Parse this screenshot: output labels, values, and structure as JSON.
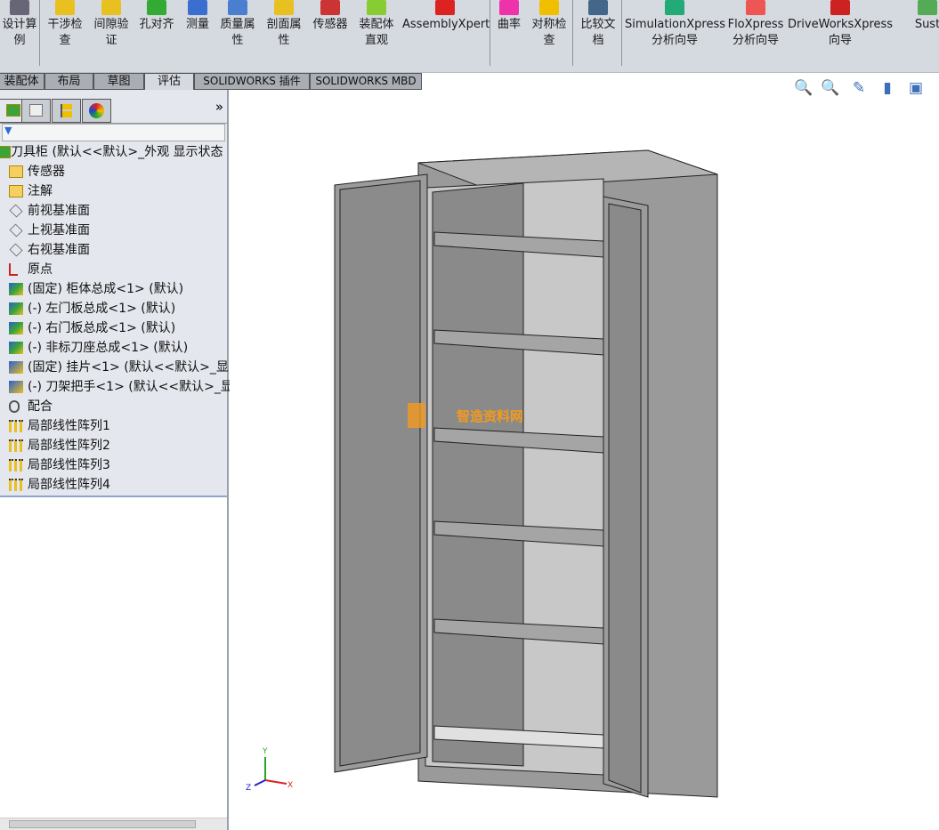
{
  "toolbar": {
    "items": [
      {
        "label": "设计算\n例",
        "icon": "design-study-icon"
      },
      {
        "label": "干涉检\n查",
        "icon": "interference-icon"
      },
      {
        "label": "间隙验\n证",
        "icon": "clearance-icon"
      },
      {
        "label": "孔对齐",
        "icon": "hole-align-icon"
      },
      {
        "label": "测量",
        "icon": "measure-icon"
      },
      {
        "label": "质量属\n性",
        "icon": "mass-properties-icon"
      },
      {
        "label": "剖面属\n性",
        "icon": "section-properties-icon"
      },
      {
        "label": "传感器",
        "icon": "sensor-icon"
      },
      {
        "label": "装配体\n直观",
        "icon": "assembly-visualization-icon"
      },
      {
        "label": "AssemblyXpert",
        "icon": "assemblyxpert-icon"
      },
      {
        "label": "曲率",
        "icon": "curvature-icon"
      },
      {
        "label": "对称检\n查",
        "icon": "symmetry-check-icon"
      },
      {
        "label": "比较文\n档",
        "icon": "compare-documents-icon"
      },
      {
        "label": "SimulationXpress\n分析向导",
        "icon": "simulationxpress-icon"
      },
      {
        "label": "FloXpress\n分析向导",
        "icon": "floxpress-icon"
      },
      {
        "label": "DriveWorksXpress\n向导",
        "icon": "driveworksxpress-icon"
      },
      {
        "label": "Sust",
        "icon": "sustainability-icon"
      }
    ]
  },
  "tabs": [
    {
      "label": "装配体"
    },
    {
      "label": "布局"
    },
    {
      "label": "草图"
    },
    {
      "label": "评估",
      "active": true
    },
    {
      "label": "SOLIDWORKS 插件"
    },
    {
      "label": "SOLIDWORKS MBD"
    }
  ],
  "panel": {
    "expand": "»",
    "filter": "▼",
    "tree": [
      {
        "label": "刀具柜  (默认<<默认>_外观 显示状态",
        "icon": "assembly-icon"
      },
      {
        "label": "传感器",
        "icon": "sensor-folder-icon"
      },
      {
        "label": "注解",
        "icon": "annotation-folder-icon"
      },
      {
        "label": "前视基准面",
        "icon": "plane-icon"
      },
      {
        "label": "上视基准面",
        "icon": "plane-icon"
      },
      {
        "label": "右视基准面",
        "icon": "plane-icon"
      },
      {
        "label": "原点",
        "icon": "origin-icon"
      },
      {
        "label": "(固定) 柜体总成<1> (默认)",
        "icon": "subassembly-icon"
      },
      {
        "label": "(-) 左门板总成<1> (默认)",
        "icon": "subassembly-icon"
      },
      {
        "label": "(-) 右门板总成<1> (默认)",
        "icon": "subassembly-icon"
      },
      {
        "label": "(-) 非标刀座总成<1> (默认)",
        "icon": "subassembly-icon"
      },
      {
        "label": "(固定) 挂片<1> (默认<<默认>_显",
        "icon": "part-icon"
      },
      {
        "label": "(-) 刀架把手<1> (默认<<默认>_显",
        "icon": "part-icon"
      },
      {
        "label": "配合",
        "icon": "mates-icon"
      },
      {
        "label": "局部线性阵列1",
        "icon": "pattern-icon"
      },
      {
        "label": "局部线性阵列2",
        "icon": "pattern-icon"
      },
      {
        "label": "局部线性阵列3",
        "icon": "pattern-icon"
      },
      {
        "label": "局部线性阵列4",
        "icon": "pattern-icon"
      }
    ]
  },
  "viewport": {
    "watermark": "智造资料网",
    "triad": {
      "x": "X",
      "y": "Y",
      "z": "Z"
    }
  },
  "colors": {
    "toolbar_bg": "#d5d9e0",
    "panel_bg": "#e4e7ed",
    "model_gray": "#8c8c8c"
  }
}
